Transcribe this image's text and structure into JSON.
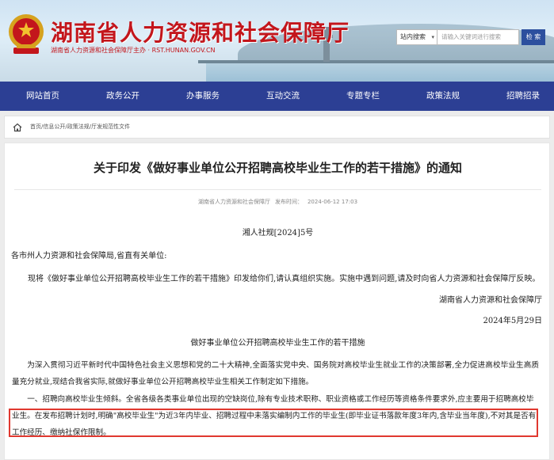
{
  "header": {
    "site_title": "湖南省人力资源和社会保障厅",
    "site_subtitle": "湖南省人力资源和社会保障厅主办 · RST.HUNAN.GOV.CN",
    "search": {
      "scope_label": "站内搜索",
      "placeholder": "请输入关键词进行搜索",
      "button_label": "检 索"
    }
  },
  "nav": {
    "items": [
      "网站首页",
      "政务公开",
      "办事服务",
      "互动交流",
      "专题专栏",
      "政策法规",
      "招聘招录"
    ]
  },
  "breadcrumb": {
    "text": "首页/信息公开/政策法规/厅发规范性文件"
  },
  "article": {
    "title": "关于印发《做好事业单位公开招聘高校毕业生工作的若干措施》的通知",
    "source": "湖南省人力资源和社会保障厅",
    "publish_label": "发布时间：",
    "publish_time": "2024-06-12 17:03",
    "doc_number": "湘人社规[2024]5号",
    "salutation": "各市州人力资源和社会保障局,省直有关单位:",
    "body": "现将《做好事业单位公开招聘高校毕业生工作的若干措施》印发给你们,请认真组织实施。实施中遇到问题,请及时向省人力资源和社会保障厅反映。",
    "signer": "湖南省人力资源和社会保障厅",
    "date": "2024年5月29日",
    "subtitle": "做好事业单位公开招聘高校毕业生工作的若干措施",
    "paragraph1": "为深入贯彻习近平新时代中国特色社会主义思想和党的二十大精神,全面落实党中央、国务院对高校毕业生就业工作的决策部署,全力促进高校毕业生高质量充分就业,现结合我省实际,就做好事业单位公开招聘高校毕业生相关工作制定如下措施。",
    "paragraph2": "一、招聘向高校毕业生倾斜。全省各级各类事业单位出现的空缺岗位,除有专业技术职称、职业资格或工作经历等资格条件要求外,应主要用于招聘高校毕业生。在发布招聘计划时,明确\"高校毕业生\"为近3年内毕业、招聘过程中未落实编制内工作的毕业生(即毕业证书落款年度3年内,含毕业当年度),不对其是否有工作经历、缴纳社保作限制。"
  },
  "colors": {
    "brand_red": "#c3161c",
    "nav_blue": "#2c3f94",
    "search_button": "#2c4f9e",
    "highlight_red": "#e0382f"
  }
}
